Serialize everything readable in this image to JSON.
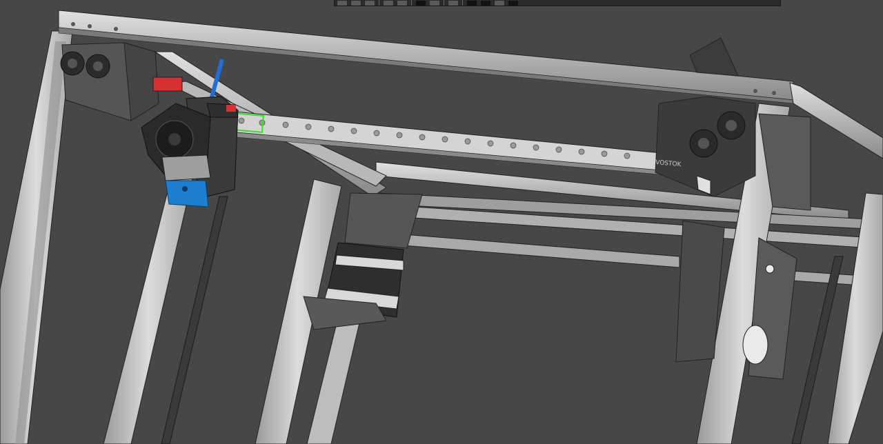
{
  "app": {
    "view": "3d-cad-viewport"
  },
  "toolbar": {
    "buttons": [
      {
        "icon": "view-front-icon"
      },
      {
        "icon": "view-top-icon"
      },
      {
        "icon": "view-right-icon"
      },
      {
        "icon": "section-icon"
      },
      {
        "icon": "measure-icon"
      },
      {
        "icon": "render-mode-icon"
      },
      {
        "icon": "shading-icon"
      },
      {
        "icon": "display-style-icon"
      },
      {
        "icon": "pin-icon"
      },
      {
        "icon": "selection-icon"
      },
      {
        "icon": "layers-icon"
      },
      {
        "icon": "settings-icon"
      }
    ]
  },
  "model": {
    "engraving": "VOSTOK",
    "colors": {
      "background": "#474747",
      "extrusion": "#c9c9c9",
      "printed_part": "#555555",
      "hotend_fan": "#2a2a2a",
      "heater_block": "#1e7fd0",
      "filament": "#1f6fd6",
      "selection_highlight": "#33e02a",
      "endstop": "#d83030",
      "rail": "#d4d4d4"
    }
  }
}
